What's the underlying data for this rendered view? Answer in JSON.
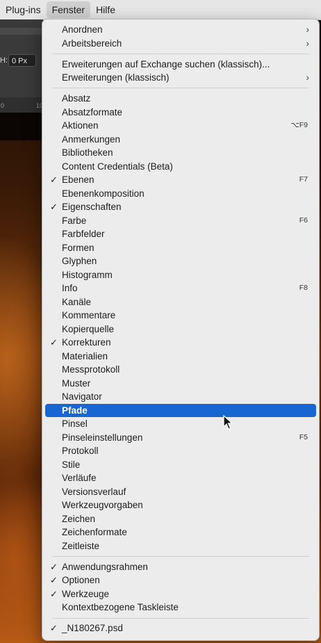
{
  "menubar": {
    "items": [
      {
        "label": "Plug-ins",
        "open": false
      },
      {
        "label": "Fenster",
        "open": true
      },
      {
        "label": "Hilfe",
        "open": false
      }
    ]
  },
  "options_bar": {
    "h_label": "H:",
    "h_value": "0 Px"
  },
  "ruler": {
    "ticks": [
      "0",
      "10"
    ]
  },
  "menu": {
    "title": "Fenster",
    "groups": [
      [
        {
          "label": "Anordnen",
          "submenu": true
        },
        {
          "label": "Arbeitsbereich",
          "submenu": true
        }
      ],
      [
        {
          "label": "Erweiterungen auf Exchange suchen (klassisch)..."
        },
        {
          "label": "Erweiterungen (klassisch)",
          "submenu": true
        }
      ],
      [
        {
          "label": "Absatz"
        },
        {
          "label": "Absatzformate"
        },
        {
          "label": "Aktionen",
          "shortcut": "⌥F9"
        },
        {
          "label": "Anmerkungen"
        },
        {
          "label": "Bibliotheken"
        },
        {
          "label": "Content Credentials (Beta)"
        },
        {
          "label": "Ebenen",
          "checked": true,
          "shortcut": "F7"
        },
        {
          "label": "Ebenenkomposition"
        },
        {
          "label": "Eigenschaften",
          "checked": true
        },
        {
          "label": "Farbe",
          "shortcut": "F6"
        },
        {
          "label": "Farbfelder"
        },
        {
          "label": "Formen"
        },
        {
          "label": "Glyphen"
        },
        {
          "label": "Histogramm"
        },
        {
          "label": "Info",
          "shortcut": "F8"
        },
        {
          "label": "Kanäle"
        },
        {
          "label": "Kommentare"
        },
        {
          "label": "Kopierquelle"
        },
        {
          "label": "Korrekturen",
          "checked": true
        },
        {
          "label": "Materialien"
        },
        {
          "label": "Messprotokoll"
        },
        {
          "label": "Muster"
        },
        {
          "label": "Navigator"
        },
        {
          "label": "Pfade",
          "highlighted": true
        },
        {
          "label": "Pinsel"
        },
        {
          "label": "Pinseleinstellungen",
          "shortcut": "F5"
        },
        {
          "label": "Protokoll"
        },
        {
          "label": "Stile"
        },
        {
          "label": "Verläufe"
        },
        {
          "label": "Versionsverlauf"
        },
        {
          "label": "Werkzeugvorgaben"
        },
        {
          "label": "Zeichen"
        },
        {
          "label": "Zeichenformate"
        },
        {
          "label": "Zeitleiste"
        }
      ],
      [
        {
          "label": "Anwendungsrahmen",
          "checked": true
        },
        {
          "label": "Optionen",
          "checked": true
        },
        {
          "label": "Werkzeuge",
          "checked": true
        },
        {
          "label": "Kontextbezogene Taskleiste"
        }
      ],
      [
        {
          "label": "_N180267.psd",
          "checked": true
        }
      ]
    ]
  },
  "symbols": {
    "check": "✓",
    "submenu_arrow": "›"
  },
  "colors": {
    "highlight": "#1766d1",
    "menu_bg": "#ececec"
  }
}
